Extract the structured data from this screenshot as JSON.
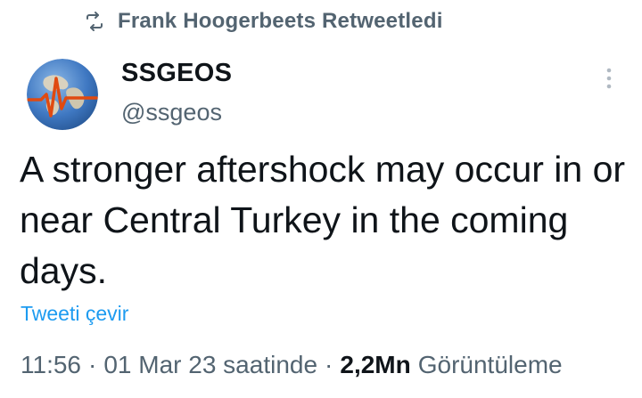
{
  "retweet": {
    "label": "Frank Hoogerbeets Retweetledi",
    "icon": "retweet-icon"
  },
  "author": {
    "display_name": "SSGEOS",
    "handle": "@ssgeos",
    "avatar_icon": "globe-seismograph-icon"
  },
  "tweet": {
    "text": "A stronger aftershock may occur in or near Central Turkey in the coming days.",
    "translate_label": "Tweeti çevir"
  },
  "meta": {
    "time": "11:56",
    "separator": "·",
    "date": "01 Mar 23 saatinde",
    "views_count": "2,2Mn",
    "views_label": "Görüntüleme"
  },
  "colors": {
    "text_primary": "#0f1419",
    "text_secondary": "#536471",
    "link": "#1d9bf0"
  }
}
